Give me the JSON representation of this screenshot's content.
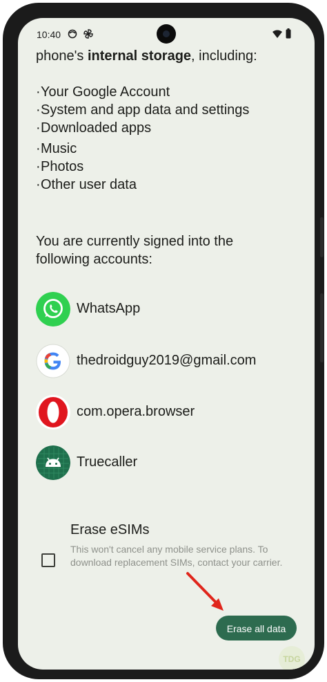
{
  "status_bar": {
    "time": "10:40"
  },
  "intro": {
    "prefix": "phone's ",
    "bold": "internal storage",
    "suffix": ", including:"
  },
  "bullets": [
    "Your Google Account",
    "System and app data and settings",
    "Downloaded apps",
    "Music",
    "Photos",
    "Other user data"
  ],
  "signed_in_text": "You are currently signed into the following accounts:",
  "accounts": [
    {
      "name": "WhatsApp",
      "icon": "whatsapp-icon"
    },
    {
      "name": "thedroidguy2019@gmail.com",
      "icon": "google-icon"
    },
    {
      "name": "com.opera.browser",
      "icon": "opera-icon"
    },
    {
      "name": "Truecaller",
      "icon": "android-icon"
    }
  ],
  "esim": {
    "title": "Erase eSIMs",
    "description": "This won't cancel any mobile service plans. To download replacement SIMs, contact your carrier.",
    "checked": false
  },
  "erase_button": {
    "label": "Erase all data"
  },
  "watermark": {
    "text": "TDG"
  },
  "colors": {
    "background": "#edf0e9",
    "accent": "#2d6b4f",
    "arrow": "#e0251b"
  }
}
